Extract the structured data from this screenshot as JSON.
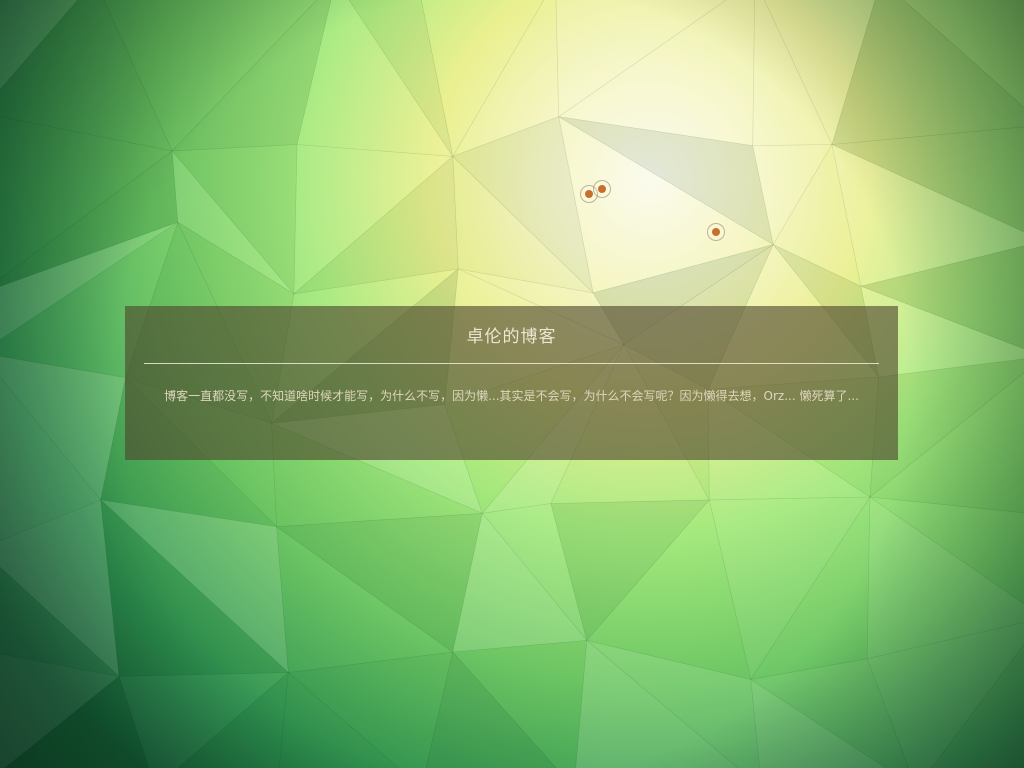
{
  "site": {
    "title": "卓伦的博客",
    "description": "博客一直都没写，不知道啥时候才能写，为什么不写，因为懒...其实是不会写，为什么不会写呢？因为懒得去想，Orz... 懒死算了..."
  },
  "background": {
    "style": "low-poly triangle mesh",
    "colors": {
      "light_glow": "#fbfbee",
      "yellow": "#f0f08a",
      "light_green": "#9be67a",
      "mid_green": "#5fb85a",
      "dark_green": "#1f7a45"
    }
  },
  "light_markers": {
    "icon": "light-source-dot-icon",
    "color": "#c8702a",
    "count": 3
  }
}
